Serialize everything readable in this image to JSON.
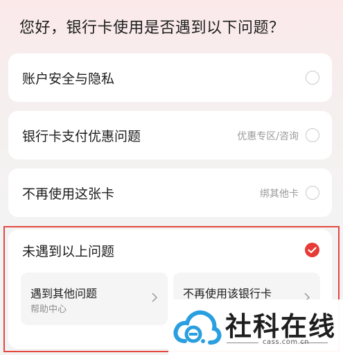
{
  "question": "您好，银行卡使用是否遇到以下问题？",
  "options": [
    {
      "label": "账户安全与隐私",
      "hint": "",
      "selected": false
    },
    {
      "label": "银行卡支付优惠问题",
      "hint": "优惠专区/咨询",
      "selected": false
    },
    {
      "label": "不再使用这张卡",
      "hint": "绑其他卡",
      "selected": false
    },
    {
      "label": "未遇到以上问题",
      "hint": "",
      "selected": true
    }
  ],
  "sub_options": [
    {
      "title": "遇到其他问题",
      "desc": "帮助中心"
    },
    {
      "title": "不再使用该银行卡",
      "desc": ""
    }
  ],
  "watermark": {
    "name": "社科在线",
    "domain": "cass.com.cn"
  },
  "colors": {
    "accent": "#e63b36",
    "highlight_border": "#e4473d"
  }
}
